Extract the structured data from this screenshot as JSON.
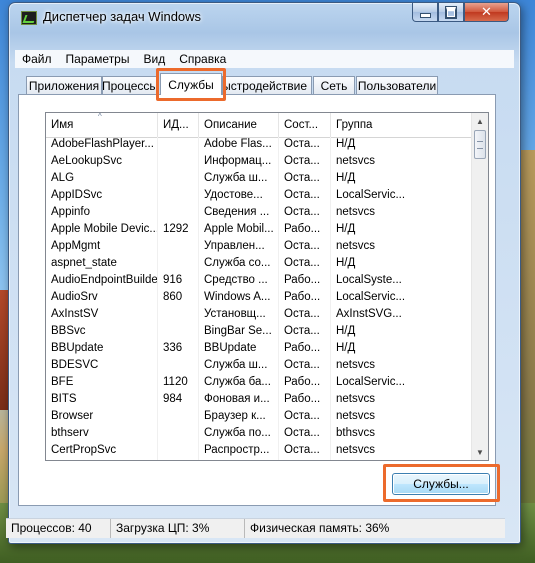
{
  "window": {
    "title": "Диспетчер задач Windows"
  },
  "menu": [
    "Файл",
    "Параметры",
    "Вид",
    "Справка"
  ],
  "tabs": [
    "Приложения",
    "Процессы",
    "Службы",
    "Быстродействие",
    "Сеть",
    "Пользователи"
  ],
  "active_tab": "Службы",
  "columns": [
    "Имя",
    "ИД...",
    "Описание",
    "Сост...",
    "Группа"
  ],
  "rows": [
    [
      "AdobeFlashPlayer...",
      "",
      "Adobe Flas...",
      "Оста...",
      "Н/Д"
    ],
    [
      "AeLookupSvc",
      "",
      "Информац...",
      "Оста...",
      "netsvcs"
    ],
    [
      "ALG",
      "",
      "Служба ш...",
      "Оста...",
      "Н/Д"
    ],
    [
      "AppIDSvc",
      "",
      "Удостове...",
      "Оста...",
      "LocalServic..."
    ],
    [
      "Appinfo",
      "",
      "Сведения ...",
      "Оста...",
      "netsvcs"
    ],
    [
      "Apple Mobile Devic...",
      "1292",
      "Apple Mobil...",
      "Рабо...",
      "Н/Д"
    ],
    [
      "AppMgmt",
      "",
      "Управлен...",
      "Оста...",
      "netsvcs"
    ],
    [
      "aspnet_state",
      "",
      "Служба со...",
      "Оста...",
      "Н/Д"
    ],
    [
      "AudioEndpointBuilder",
      "916",
      "Средство ...",
      "Рабо...",
      "LocalSyste..."
    ],
    [
      "AudioSrv",
      "860",
      "Windows A...",
      "Рабо...",
      "LocalServic..."
    ],
    [
      "AxInstSV",
      "",
      "Установщ...",
      "Оста...",
      "AxInstSVG..."
    ],
    [
      "BBSvc",
      "",
      "BingBar Se...",
      "Оста...",
      "Н/Д"
    ],
    [
      "BBUpdate",
      "336",
      "BBUpdate",
      "Рабо...",
      "Н/Д"
    ],
    [
      "BDESVC",
      "",
      "Служба ш...",
      "Оста...",
      "netsvcs"
    ],
    [
      "BFE",
      "1120",
      "Служба ба...",
      "Рабо...",
      "LocalServic..."
    ],
    [
      "BITS",
      "984",
      "Фоновая и...",
      "Рабо...",
      "netsvcs"
    ],
    [
      "Browser",
      "",
      "Браузер к...",
      "Оста...",
      "netsvcs"
    ],
    [
      "bthserv",
      "",
      "Служба по...",
      "Оста...",
      "bthsvcs"
    ],
    [
      "CertPropSvc",
      "",
      "Распростр...",
      "Оста...",
      "netsvcs"
    ]
  ],
  "services_button": "Службы...",
  "status": {
    "processes": "Процессов: 40",
    "cpu": "Загрузка ЦП: 3%",
    "memory": "Физическая память: 36%"
  },
  "colors": {
    "highlight": "#ec6a2c",
    "window_frame": "#a9c6e6"
  }
}
